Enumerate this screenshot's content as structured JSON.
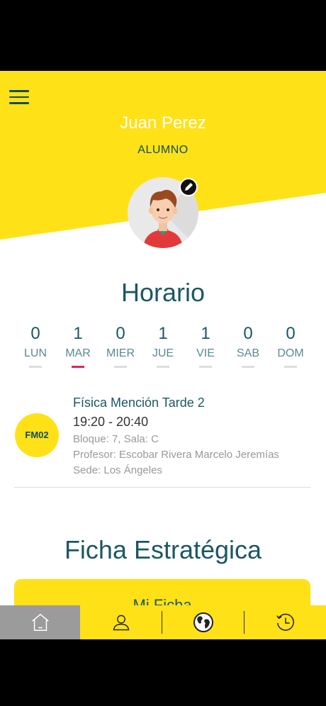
{
  "profile": {
    "name": "Juan Perez",
    "role": "ALUMNO"
  },
  "colors": {
    "accent": "#ffe117",
    "primary_text": "#1c5763",
    "active_indicator": "#e2245b",
    "selected_tab": "#9b9b9b"
  },
  "horario": {
    "title": "Horario",
    "days": [
      {
        "label": "LUN",
        "count": "0",
        "active": false
      },
      {
        "label": "MAR",
        "count": "1",
        "active": true
      },
      {
        "label": "MIER",
        "count": "0",
        "active": false
      },
      {
        "label": "JUE",
        "count": "1",
        "active": false
      },
      {
        "label": "VIE",
        "count": "1",
        "active": false
      },
      {
        "label": "SAB",
        "count": "0",
        "active": false
      },
      {
        "label": "DOM",
        "count": "0",
        "active": false
      }
    ],
    "class": {
      "code": "FM02",
      "name": "Física Mención Tarde 2",
      "time": "19:20 - 20:40",
      "bloque": "Bloque:  7, Sala: C",
      "profesor": "Profesor:  Escobar Rivera Marcelo Jeremías",
      "sede": "Sede:  Los Ángeles"
    }
  },
  "ficha": {
    "title": "Ficha Estratégica",
    "card_label": "Mi Ficha"
  },
  "tabs": [
    {
      "name": "home",
      "icon": "home-icon",
      "selected": true
    },
    {
      "name": "profile",
      "icon": "user-icon",
      "selected": false
    },
    {
      "name": "globe",
      "icon": "globe-icon",
      "selected": false
    },
    {
      "name": "history",
      "icon": "history-icon",
      "selected": false
    }
  ]
}
